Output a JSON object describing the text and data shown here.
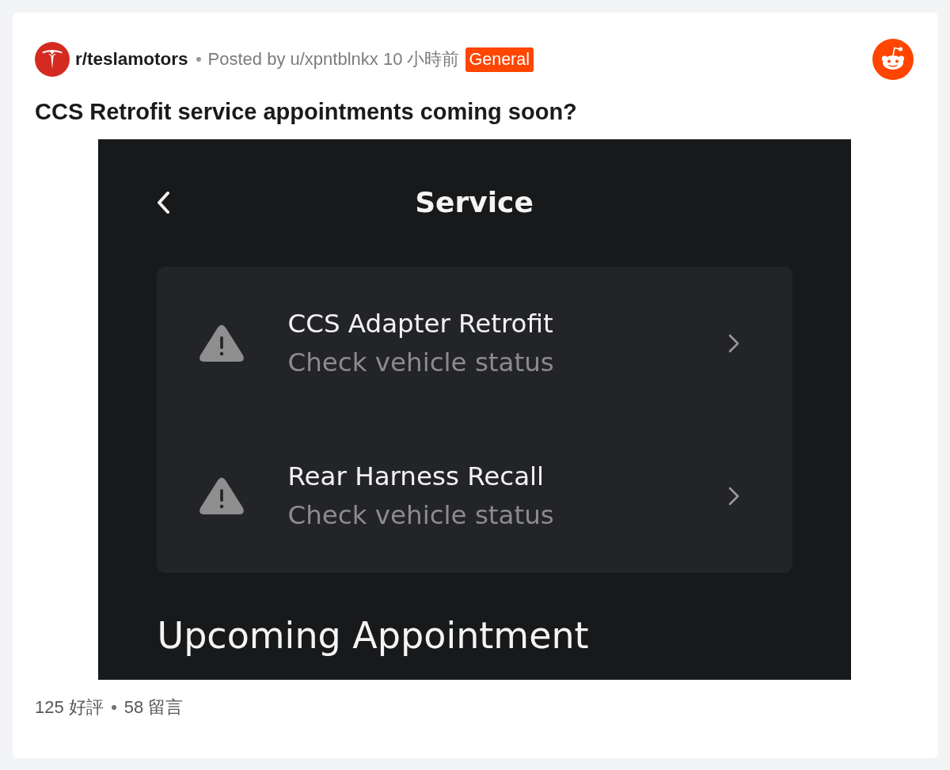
{
  "post": {
    "subreddit": "r/teslamotors",
    "byline": "Posted by u/xpntblnkx 10 小時前",
    "flair": "General",
    "title": "CCS Retrofit service appointments coming soon?"
  },
  "screenshot": {
    "title": "Service",
    "items": [
      {
        "title": "CCS Adapter Retrofit",
        "status": "Check vehicle status"
      },
      {
        "title": "Rear Harness Recall",
        "status": "Check vehicle status"
      }
    ],
    "section_heading": "Upcoming Appointment"
  },
  "footer": {
    "upvotes": "125 好評",
    "comments": "58 留言"
  }
}
